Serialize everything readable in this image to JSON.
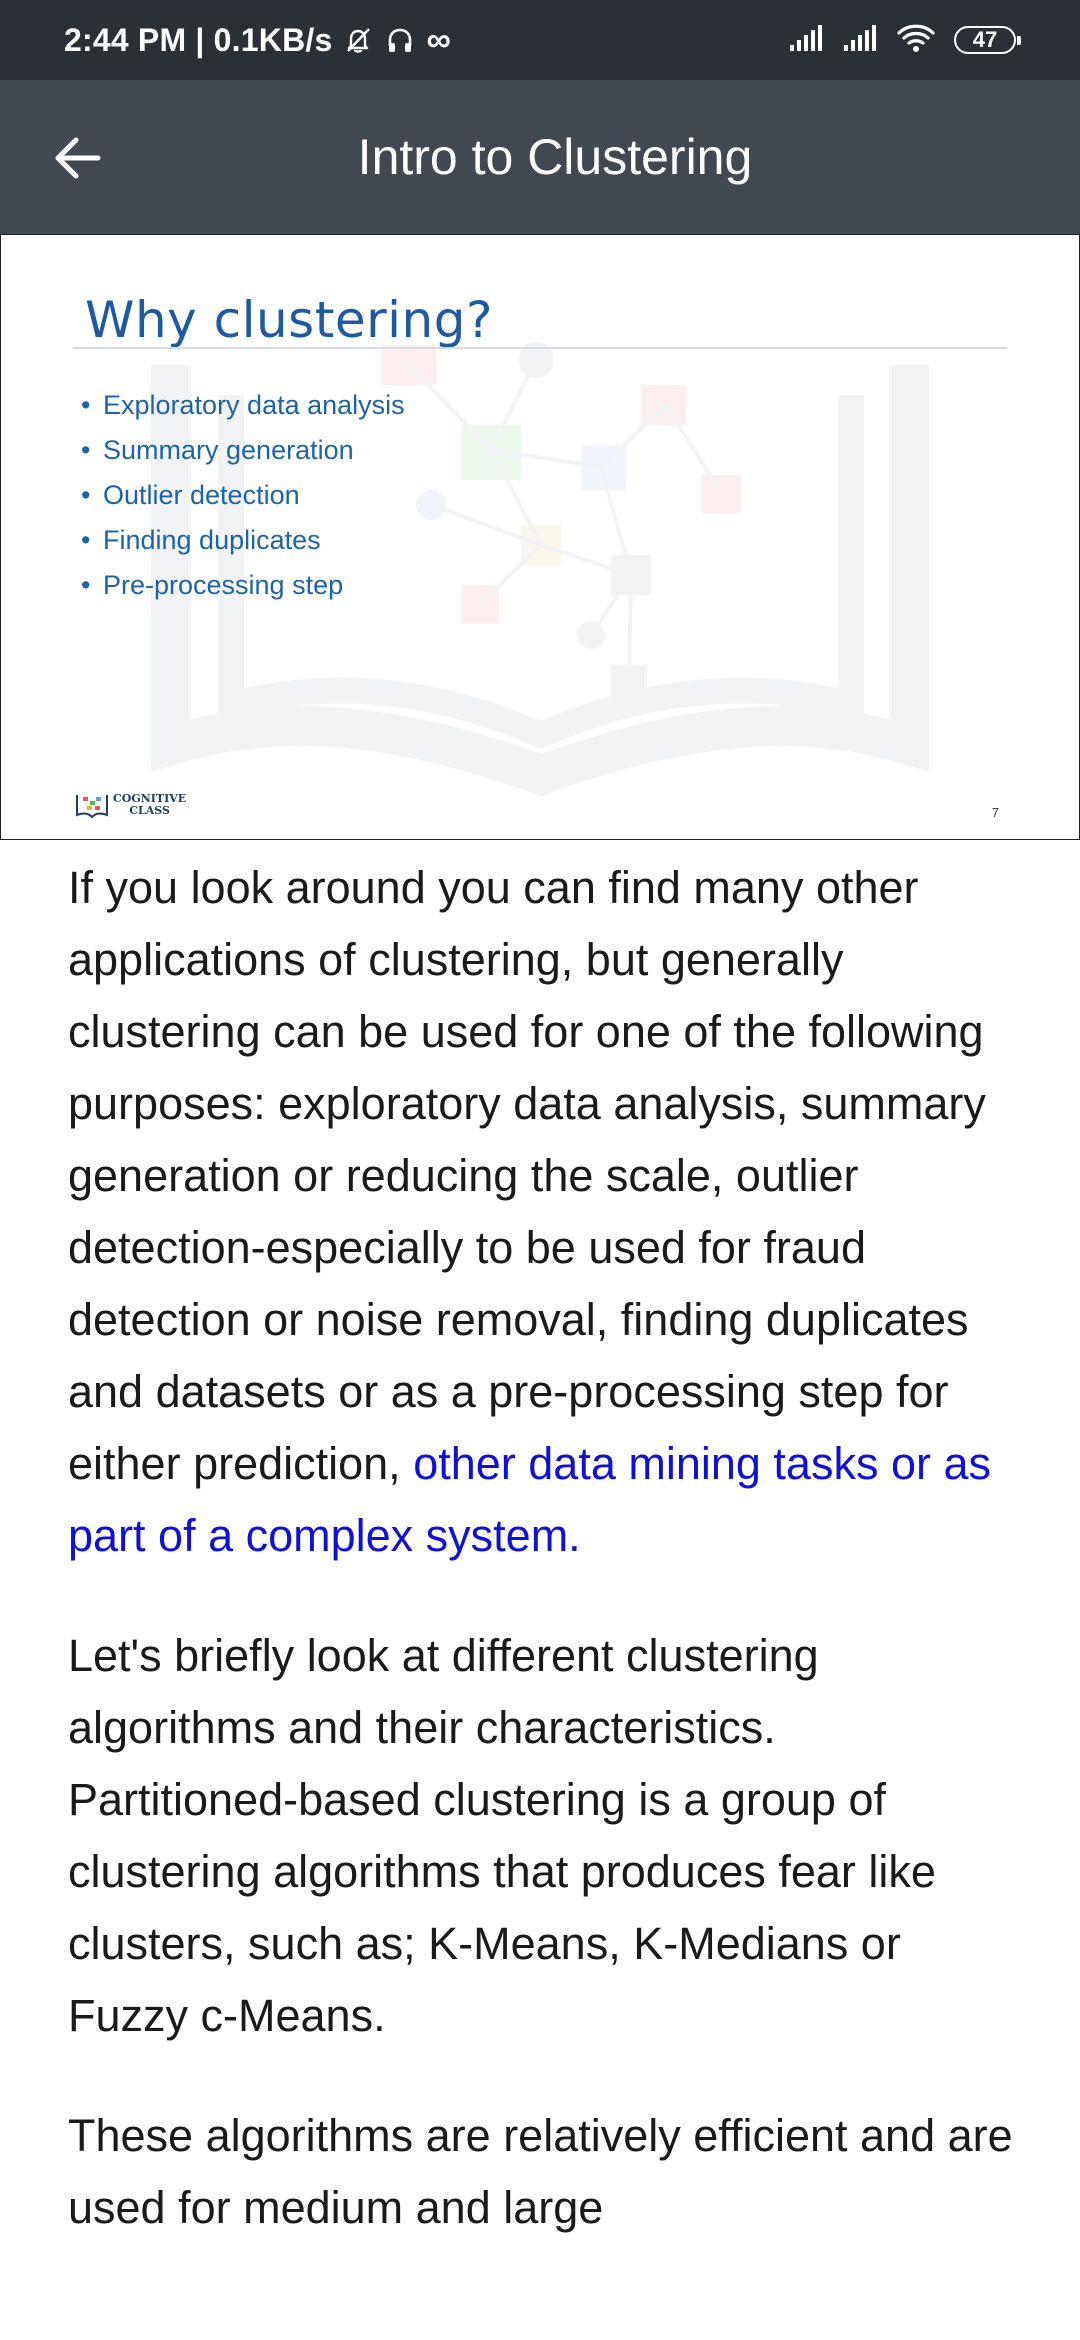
{
  "status_bar": {
    "time_speed": "2:44 PM | 0.1KB/s",
    "infinity": "∞",
    "battery": "47"
  },
  "app_bar": {
    "title": "Intro to Clustering"
  },
  "slide": {
    "title": "Why clustering?",
    "bullets": [
      "Exploratory data analysis",
      "Summary generation",
      "Outlier detection",
      "Finding duplicates",
      "Pre-processing step"
    ],
    "logo_line1": "COGNITIVE",
    "logo_line2": "CLASS",
    "page_number": "7"
  },
  "article": {
    "p1_text": "If you look around you can find many other applications of clustering, but generally clustering can be used for one of the following purposes: exploratory data analysis, summary generation or reducing the scale, outlier detection-especially to be used for fraud detection or noise removal, finding duplicates and datasets or as a pre-processing step for either prediction, ",
    "p1_highlight": "other data mining tasks or as part of a complex system.",
    "p2": "Let's briefly look at different clustering algorithms and their characteristics. Partitioned-based clustering is a group of clustering algorithms that produces fear like clusters, such as; K-Means, K-Medians or Fuzzy c-Means.",
    "p3": "These algorithms are relatively efficient and are used for medium and large"
  },
  "colors": {
    "status_bar_bg": "#2b3036",
    "app_bar_bg": "#414850",
    "slide_title": "#1f5aa0",
    "slide_bullet": "#1d63a8",
    "link_highlight": "#1010d8"
  }
}
